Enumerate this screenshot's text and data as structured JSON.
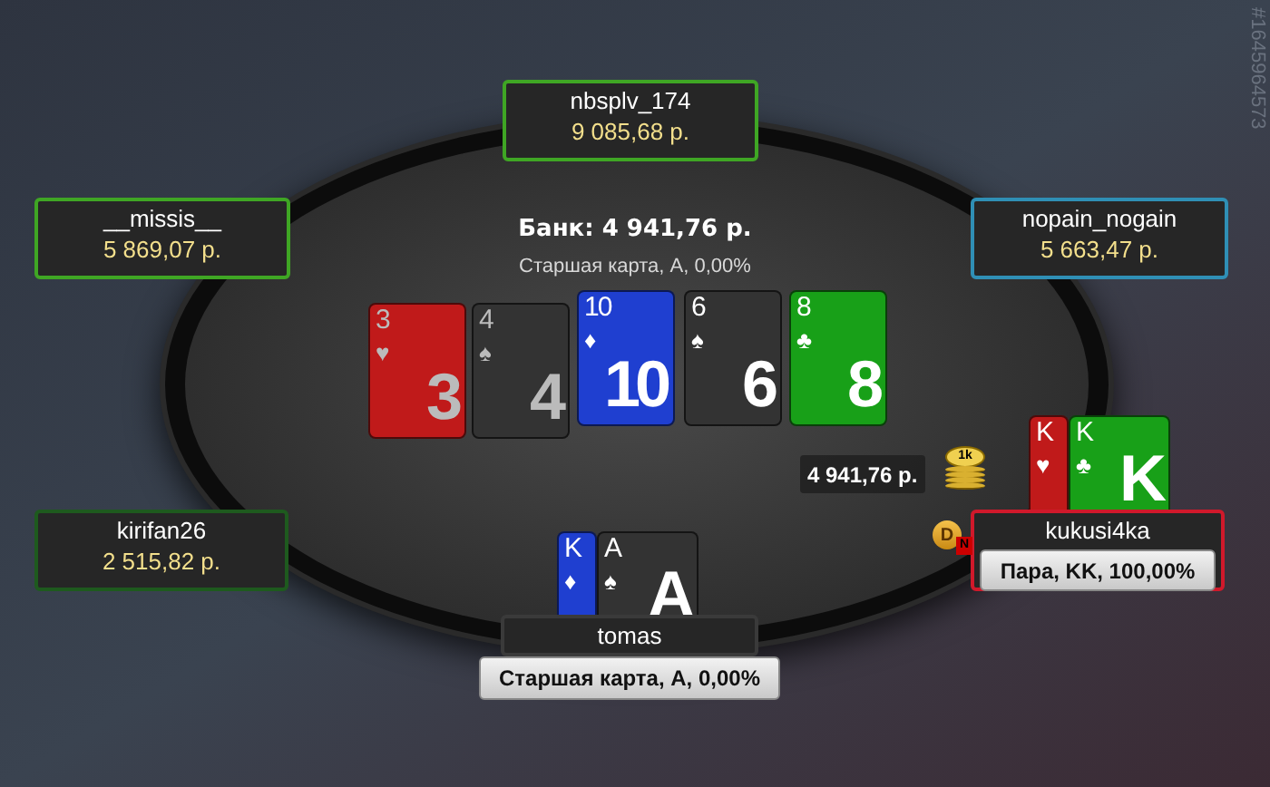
{
  "hand_id": "#1645964573",
  "pot": {
    "label": "Банк: 4 941,76 р.",
    "hand_name": "Старшая карта, A, 0,00%"
  },
  "board": [
    {
      "rank": "3",
      "suit": "♥",
      "face": "3",
      "color": "#c01a1a",
      "highlighted": false
    },
    {
      "rank": "4",
      "suit": "♠",
      "face": "4",
      "color": "#333333",
      "highlighted": false
    },
    {
      "rank": "10",
      "suit": "♦",
      "face": "10",
      "color": "#1f3fd0",
      "highlighted": true
    },
    {
      "rank": "6",
      "suit": "♠",
      "face": "6",
      "color": "#333333",
      "highlighted": true
    },
    {
      "rank": "8",
      "suit": "♣",
      "face": "8",
      "color": "#18a018",
      "highlighted": true
    }
  ],
  "seats": [
    {
      "name": "nbsplv_174",
      "stack": "9 085,68 р.",
      "color": "#3fa624"
    },
    {
      "name": "__missis__",
      "stack": "5 869,07 р.",
      "color": "#3fa624"
    },
    {
      "name": "nopain_nogain",
      "stack": "5 663,47 р.",
      "color": "#2f8fb5"
    },
    {
      "name": "kirifan26",
      "stack": "2 515,82 р.",
      "color": "#1e5a1e"
    },
    {
      "name": "kukusi4ka",
      "hand": "Пара, KK, 100,00%",
      "color": "#d0192b",
      "cards": [
        {
          "rank": "K",
          "suit": "♥",
          "color": "#c01a1a"
        },
        {
          "rank": "K",
          "suit": "♣",
          "face": "K",
          "color": "#18a018"
        }
      ]
    },
    {
      "name": "tomas",
      "hand": "Старшая карта, A, 0,00%",
      "color": "#3a3a3a",
      "cards": [
        {
          "rank": "K",
          "suit": "♦",
          "color": "#1f3fd0"
        },
        {
          "rank": "A",
          "suit": "♠",
          "face": "A",
          "color": "#333333"
        }
      ]
    }
  ],
  "bet": {
    "amount": "4 941,76 р.",
    "chip_label": "1k"
  },
  "dealer_button": {
    "label": "D",
    "tag": "N"
  }
}
